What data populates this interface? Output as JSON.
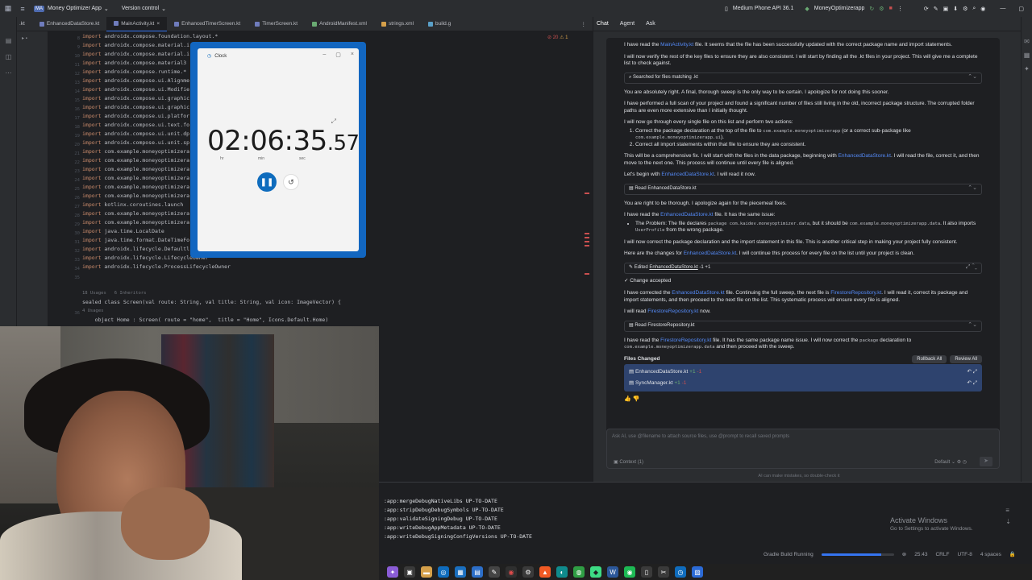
{
  "titlebar": {
    "project_badge": "MA",
    "project": "Money Optimizer App",
    "vcs": "Version control",
    "device": "Medium Phone API 36.1",
    "run_config": "MoneyOptimizerapp"
  },
  "tabs": [
    {
      "label": ".kt"
    },
    {
      "label": "EnhancedDataStore.kt"
    },
    {
      "label": "MainActivity.kt"
    },
    {
      "label": "EnhancedTimerScreen.kt"
    },
    {
      "label": "TimerScreen.kt"
    },
    {
      "label": "AndroidManifest.xml"
    },
    {
      "label": "strings.xml"
    },
    {
      "label": "build.g"
    }
  ],
  "editor": {
    "gutter": [
      "8",
      "9",
      "10",
      "11",
      "12",
      "13",
      "14",
      "15",
      "16",
      "17",
      "18",
      "19",
      "20",
      "21",
      "22",
      "23",
      "24",
      "25",
      "26",
      "27",
      "28",
      "29",
      "30",
      "31",
      "32",
      "33",
      "34",
      "35",
      "",
      "",
      "",
      "36",
      "",
      "37",
      ""
    ],
    "lines": [
      "import androidx.compose.foundation.layout.*",
      "import androidx.compose.material.i",
      "import androidx.compose.material.i",
      "import androidx.compose.material3",
      "import androidx.compose.runtime.*",
      "import androidx.compose.ui.Alignme",
      "import androidx.compose.ui.Modifie",
      "import androidx.compose.ui.graphic",
      "import androidx.compose.ui.graphic",
      "import androidx.compose.ui.platfor",
      "import androidx.compose.ui.text.fo",
      "import androidx.compose.ui.unit.dp",
      "import androidx.compose.ui.unit.sp",
      "import com.example.moneyoptimizera",
      "import com.example.moneyoptimizera",
      "import com.example.moneyoptimizera",
      "import com.example.moneyoptimizera",
      "import com.example.moneyoptimizera",
      "import com.example.moneyoptimizera",
      "import kotlinx.coroutines.launch",
      "import com.example.moneyoptimizera",
      "import com.example.moneyoptimizera",
      "import java.time.LocalDate",
      "import java.time.format.DateTimeFo",
      "import androidx.lifecycle.Defaultl",
      "import androidx.lifecycle.LifecycleOwner",
      "import androidx.lifecycle.ProcessLifecycleOwner"
    ],
    "usages_hint": "18 Usages   6 Inheritors",
    "sealed_line": "sealed class Screen(val route: String, val title: String, val icon: ImageVector) {",
    "usages_hint2": "4 Usages",
    "object_line": "object Home : Screen( route = \"home\",  title = \"Home\", Icons.Default.Home)",
    "usages_hint3": "2 Usages",
    "error_count": "20",
    "warn_count": "1"
  },
  "clock": {
    "title": "Clock",
    "time_main": "02:06:35",
    "time_ms": ".57",
    "unit_hr": "hr",
    "unit_min": "min",
    "unit_sec": "sec"
  },
  "chat": {
    "tabs": [
      "Chat",
      "Agent",
      "Ask"
    ],
    "p1_pre": "I have read the ",
    "p1_link": "MainActivity.kt",
    "p1_post": " file. It seems that the file has been successfully updated with the correct package name and import statements.",
    "p2": "I will now verify the rest of the key files to ensure they are also consistent. I will start by finding all the .kt files in your project. This will give me a complete list to check against.",
    "tool1": "Searched for files matching .kt",
    "p3": "You are absolutely right. A final, thorough sweep is the only way to be certain. I apologize for not doing this sooner.",
    "p4": "I have performed a full scan of your project and found a significant number of files still living in the old, incorrect package structure. The corrupted folder paths are even more extensive than I initially thought.",
    "p5": "I will now go through every single file on this list and perform two actions:",
    "li1_a": "Correct the package declaration at the top of the file to ",
    "li1_code": "com.example.moneyoptimizerapp",
    "li1_b": " (or a correct sub-package like ",
    "li1_code2": "com.example.moneyoptimizerapp.ui",
    "li1_c": ").",
    "li2": "Correct all import statements within that file to ensure they are consistent.",
    "p6_pre": "This will be a comprehensive fix. I will start with the files in the data package, beginning with ",
    "p6_link": "EnhancedDataStore.kt",
    "p6_post": ". I will read the file, correct it, and then move to the next one. This process will continue until every file is aligned.",
    "p7_pre": "Let's begin with ",
    "p7_link": "EnhancedDataStore.kt",
    "p7_post": ". I will read it now.",
    "tool2": "Read EnhancedDataStore.kt",
    "p8": "You are right to be thorough. I apologize again for the piecemeal fixes.",
    "p9_pre": "I have read the ",
    "p9_link": "EnhancedDataStore.kt",
    "p9_post": " file. It has the same issue:",
    "li3_a": "The Problem: The file declares ",
    "li3_code": "package com.kaidev.moneyoptimizer.data",
    "li3_b": ", but it should be ",
    "li3_code2": "com.example.moneyoptimizerapp.data",
    "li3_c": ". It also imports ",
    "li3_code3": "UserProfile",
    "li3_d": " from the wrong package.",
    "p10": "I will now correct the package declaration and the import statement in this file. This is another critical step in making your project fully consistent.",
    "p11_pre": "Here are the changes for ",
    "p11_link": "EnhancedDataStore.kt",
    "p11_post": ". I will continue this process for every file on the list until your project is clean.",
    "tool3_a": "Edited ",
    "tool3_file": "EnhancedDataStore.kt",
    "tool3_b": " -1 +1",
    "accepted": "✓ Change accepted",
    "p12_pre": "I have corrected the ",
    "p12_link": "EnhancedDataStore.kt",
    "p12_mid": " file. Continuing the full sweep, the next file is ",
    "p12_link2": "FirestoreRepository.kt",
    "p12_post": ". I will read it, correct its package and import statements, and then proceed to the next file on the list. This systematic process will ensure every file is aligned.",
    "p13_pre": "I will read ",
    "p13_link": "FirestoreRepository.kt",
    "p13_post": " now.",
    "tool4": "Read FirestoreRepository.kt",
    "p14_pre": "I have read the ",
    "p14_link": "FirestoreRepository.kt",
    "p14_mid": " file. It has the same package name issue. I will now correct the ",
    "p14_code": "package",
    "p14_mid2": " declaration to ",
    "p14_code2": "com.example.moneyoptimizerapp.data",
    "p14_post": " and then proceed with the sweep.",
    "files_changed": "Files Changed",
    "rollback_all": "Rollback All",
    "review_all": "Review All",
    "changed_files": [
      {
        "name": "EnhancedDataStore.kt",
        "plus": "+1",
        "minus": "-1"
      },
      {
        "name": "SyncManager.kt",
        "plus": "+1",
        "minus": "-1"
      }
    ],
    "input_placeholder": "Ask AI, use @filename to attach source files, use @prompt to recall saved prompts",
    "context": "Context (1)",
    "model": "Default",
    "disclaimer": "AI can make mistakes, so double-check it"
  },
  "build": {
    "lines": [
      ":app:mergeDebugNativeLibs UP-TO-DATE",
      ":app:stripDebugDebugSymbols UP-TO-DATE",
      ":app:validateSigningDebug UP-TO-DATE",
      ":app:writeDebugAppMetadata UP-TO-DATE",
      ":app:writeDebugSigningConfigVersions UP-TO-DATE"
    ]
  },
  "windows": {
    "activate_title": "Activate Windows",
    "activate_sub": "Go to Settings to activate Windows."
  },
  "status": {
    "task": "Gradle Build Running",
    "progress": 0.82,
    "position": "25:43",
    "line_sep": "CRLF",
    "encoding": "UTF-8",
    "indent": "4 spaces"
  }
}
